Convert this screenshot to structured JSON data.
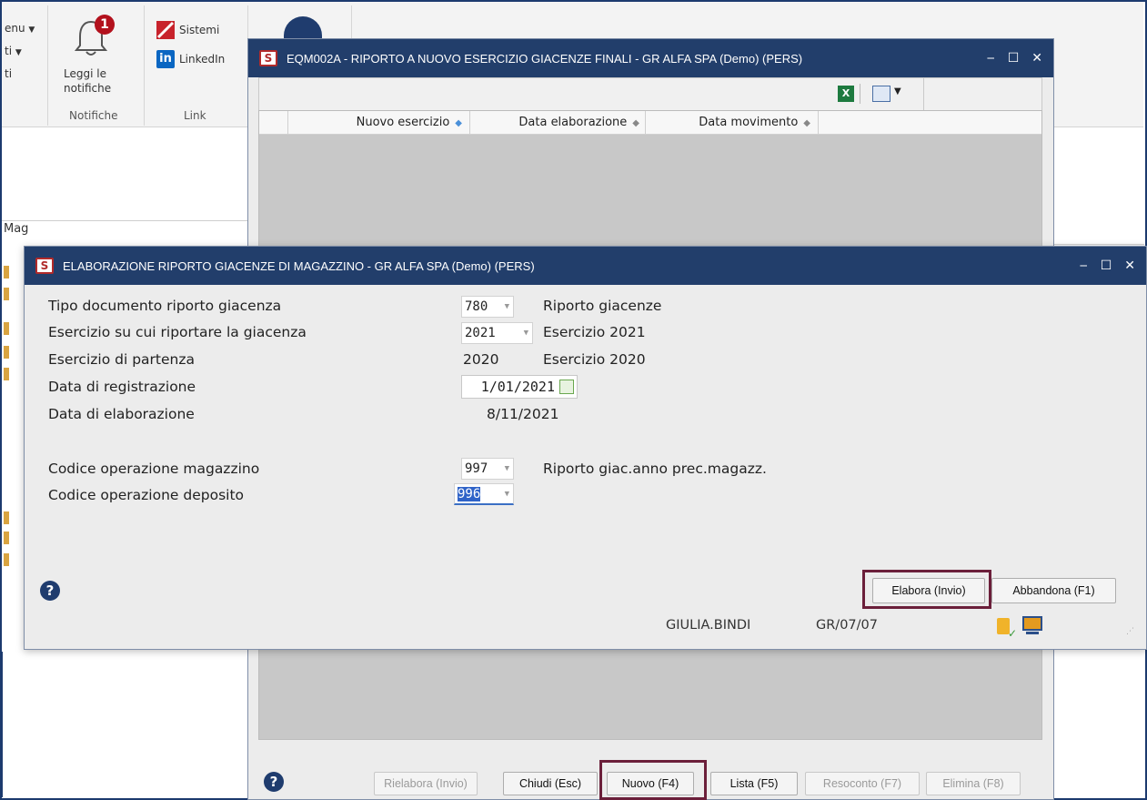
{
  "ribbon": {
    "menu_label": "enu",
    "item2_label": "ti",
    "item3_label": "ti",
    "notifications": {
      "label_line1": "Leggi le",
      "label_line2": "notifiche",
      "badge": "1",
      "group_label": "Notifiche"
    },
    "links": {
      "sistemi": "Sistemi",
      "linkedin": "LinkedIn",
      "linkedin_icon_text": "in",
      "group_label": "Link"
    }
  },
  "left_pane": {
    "label_fragment": "Mag"
  },
  "bg_window": {
    "title": "EQM002A - RIPORTO A NUOVO ESERCIZIO GIACENZE FINALI - GR ALFA SPA  (Demo) (PERS)",
    "grid": {
      "columns": [
        "Nuovo esercizio",
        "Data elaborazione",
        "Data movimento"
      ]
    },
    "buttons": {
      "rielabora": "Rielabora (Invio)",
      "chiudi": "Chiudi (Esc)",
      "nuovo": "Nuovo (F4)",
      "lista": "Lista (F5)",
      "resoconto": "Resoconto (F7)",
      "elimina": "Elimina (F8)"
    }
  },
  "dialog": {
    "title": "ELABORAZIONE RIPORTO GIACENZE DI MAGAZZINO - GR ALFA SPA  (Demo) (PERS)",
    "fields": {
      "tipo_documento": {
        "label": "Tipo documento riporto giacenza",
        "value": "780",
        "description": "Riporto giacenze"
      },
      "esercizio_riporto": {
        "label": "Esercizio su cui riportare la giacenza",
        "value": "2021",
        "description": "Esercizio 2021"
      },
      "esercizio_partenza": {
        "label": "Esercizio di partenza",
        "value": "2020",
        "description": "Esercizio 2020"
      },
      "data_registrazione": {
        "label": "Data di registrazione",
        "value": "1/01/2021"
      },
      "data_elaborazione": {
        "label": "Data di elaborazione",
        "value": "8/11/2021"
      },
      "codice_magazzino": {
        "label": "Codice operazione magazzino",
        "value": "997",
        "description": "Riporto giac.anno prec.magazz."
      },
      "codice_deposito": {
        "label": "Codice operazione deposito",
        "value": "996"
      }
    },
    "buttons": {
      "elabora": "Elabora (Invio)",
      "abbandona": "Abbandona (F1)"
    },
    "status": {
      "user": "GIULIA.BINDI",
      "code": "GR/07/07"
    }
  },
  "window_controls": {
    "minimize": "‒",
    "maximize": "☐",
    "close": "✕"
  },
  "colors": {
    "titlebar": "#223e6b",
    "highlight": "#6b1f3a",
    "help": "#1f3c6e"
  }
}
